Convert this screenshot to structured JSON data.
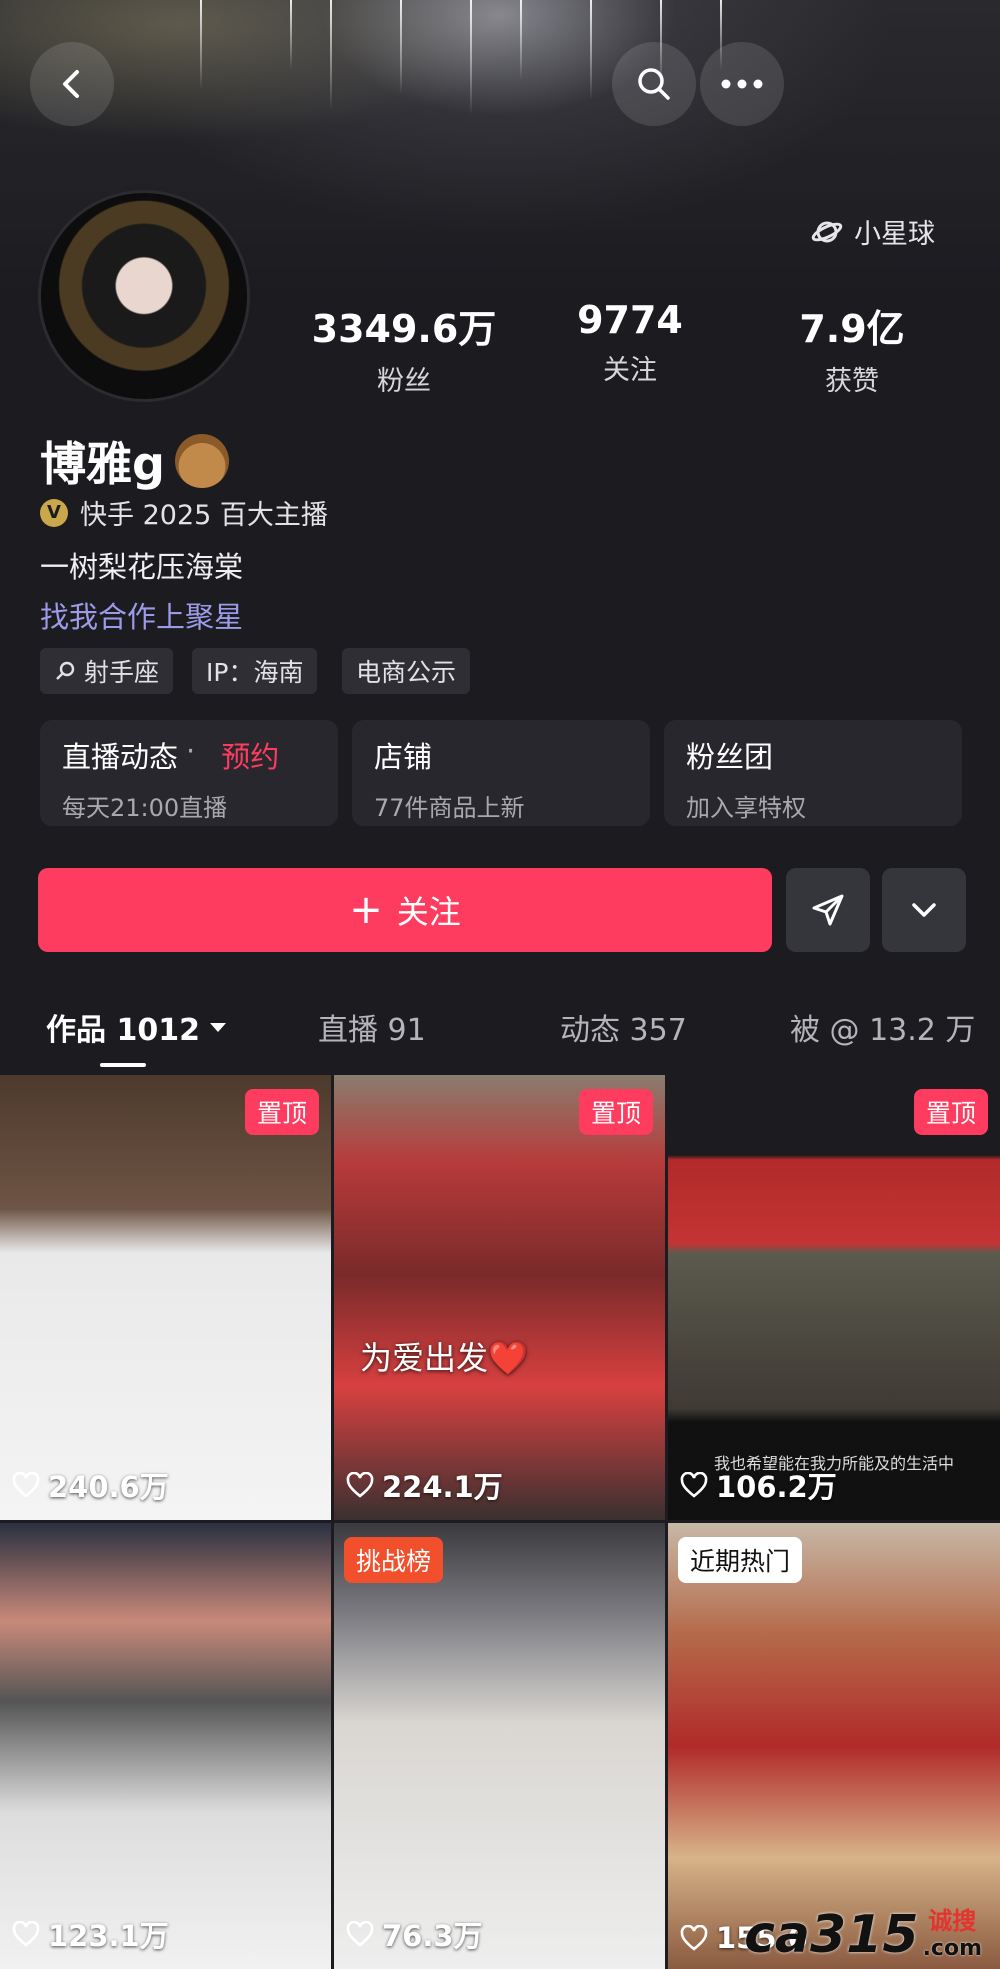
{
  "icons": {
    "back": "back-arrow-icon",
    "search": "search-icon",
    "more": "more-dots-icon",
    "planet": "planet-icon",
    "send": "send-icon",
    "chevron": "chevron-down-icon",
    "heart": "heart-icon"
  },
  "header": {
    "star_planet_label": "小星球"
  },
  "stats": [
    {
      "value": "3349.6万",
      "label": "粉丝"
    },
    {
      "value": "9774",
      "label": "关注"
    },
    {
      "value": "7.9亿",
      "label": "获赞"
    }
  ],
  "profile": {
    "name": "博雅g",
    "verify_badge": "V",
    "verify_text": "快手 2025 百大主播",
    "bio": "一树梨花压海棠",
    "link_text": "找我合作上聚星",
    "tags": [
      "射手座",
      "IP：海南",
      "电商公示"
    ]
  },
  "cards": [
    {
      "title": "直播动态",
      "separator": "·",
      "highlight": "预约",
      "subtitle": "每天21:00直播"
    },
    {
      "title": "店铺",
      "subtitle": "77件商品上新"
    },
    {
      "title": "粉丝团",
      "subtitle": "加入享特权"
    }
  ],
  "actions": {
    "follow_label": "关注",
    "follow_plus": "+"
  },
  "tabs": [
    {
      "label": "作品 1012",
      "active": true
    },
    {
      "label": "直播 91"
    },
    {
      "label": "动态 357"
    },
    {
      "label": "被 @ 13.2 万"
    }
  ],
  "grid": [
    {
      "badge": "置顶",
      "likes": "240.6万"
    },
    {
      "badge": "置顶",
      "likes": "224.1万",
      "overlay": "为爱出发❤️"
    },
    {
      "badge": "置顶",
      "likes": "106.2万",
      "caption": "我也希望能在我力所能及的生活中"
    },
    {
      "likes": "123.1万"
    },
    {
      "badge": "挑战榜",
      "likes": "76.3万"
    },
    {
      "badge": "近期热门",
      "likes": "155.6"
    }
  ],
  "watermark": {
    "logo": "ca315",
    "brand": "诚搜",
    "domain": ".com"
  },
  "colors": {
    "accent": "#fe3c5f",
    "link": "#9d9be8",
    "background": "#1b1b20"
  }
}
